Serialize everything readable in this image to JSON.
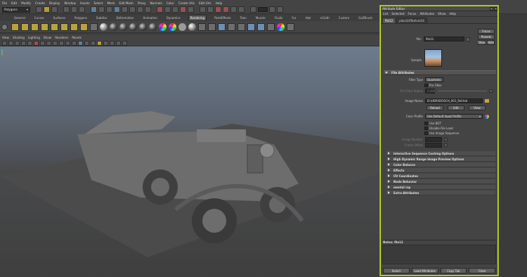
{
  "menubar": [
    "File",
    "Edit",
    "Modify",
    "Create",
    "Display",
    "Window",
    "Assets",
    "Select",
    "Mesh",
    "Edit Mesh",
    "Proxy",
    "Normals",
    "Color",
    "Create UVs",
    "Edit UVs",
    "Help"
  ],
  "statusline": {
    "menu_set": "Polygons"
  },
  "shelf_tabs": [
    "General",
    "Curves",
    "Surfaces",
    "Polygons",
    "Subdivs",
    "Deformation",
    "Animation",
    "Dynamics",
    "Rendering",
    "PaintEffects",
    "Toon",
    "Muscle",
    "Fluids",
    "Fur",
    "Hair",
    "nCloth",
    "Custom",
    "GoZBrush"
  ],
  "shelf_active_tab": "Rendering",
  "panel_menu": [
    "View",
    "Shading",
    "Lighting",
    "Show",
    "Renderer",
    "Panels"
  ],
  "attribute_editor": {
    "title": "Attribute Editor",
    "menu": [
      "List",
      "Selected",
      "Focus",
      "Attributes",
      "Show",
      "Help"
    ],
    "tabs": [
      "file12",
      "place2dTexture14"
    ],
    "file_label": "file:",
    "file_value": "file12",
    "focus_btn": "Focus",
    "presets_btn": "Presets",
    "show_btn": "Show",
    "hide_btn": "Hide",
    "sample_label": "Sample",
    "file_attributes_header": "File Attributes",
    "filter_type_label": "Filter Type",
    "filter_type_value": "Quadratic",
    "pre_filter_label": "Pre Filter",
    "pre_filter_radius_label": "Pre Filter Radius",
    "pre_filter_radius_value": "2.000",
    "image_name_label": "Image Name",
    "image_name_value": "D:\\HDRI\\DOSCH_001_Ref.hdr",
    "reload_btn": "Reload",
    "edit_btn": "Edit",
    "view_btn": "View",
    "color_profile_label": "Color Profile",
    "color_profile_value": "Use Default Input Profile",
    "use_bot_label": "Use BOT",
    "disable_file_load_label": "Disable File Load",
    "use_image_sequence_label": "Use Image Sequence",
    "image_number_label": "Image Number",
    "frame_offset_label": "Frame Offset",
    "collapsed_sections": [
      "Interactive Sequence Caching Options",
      "High Dynamic Range Image Preview Options",
      "Color Balance",
      "Effects",
      "UV Coordinates",
      "Node Behavior",
      "mental ray",
      "Extra Attributes"
    ],
    "notes_label": "Notes: file12",
    "bottom_buttons": [
      "Select",
      "Load Attributes",
      "Copy Tab",
      "Close"
    ]
  },
  "accent_color": "#c6e02a"
}
